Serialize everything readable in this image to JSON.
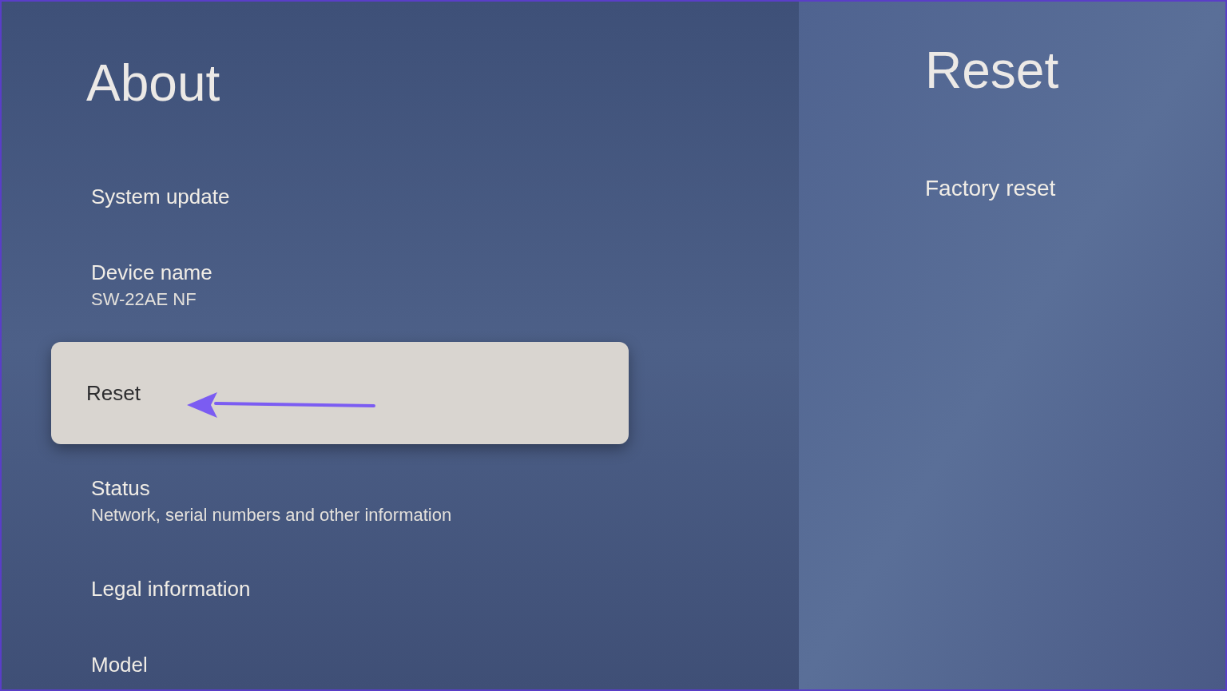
{
  "left_panel": {
    "title": "About",
    "items": [
      {
        "label": "System update",
        "selected": false
      },
      {
        "label": "Device name",
        "summary": "SW-22AE NF",
        "selected": false
      },
      {
        "label": "Reset",
        "selected": true
      },
      {
        "label": "Status",
        "summary": "Network, serial numbers and other information",
        "selected": false
      },
      {
        "label": "Legal information",
        "selected": false
      },
      {
        "label": "Model",
        "selected": false
      }
    ]
  },
  "right_panel": {
    "title": "Reset",
    "items": [
      {
        "label": "Factory reset"
      }
    ]
  }
}
